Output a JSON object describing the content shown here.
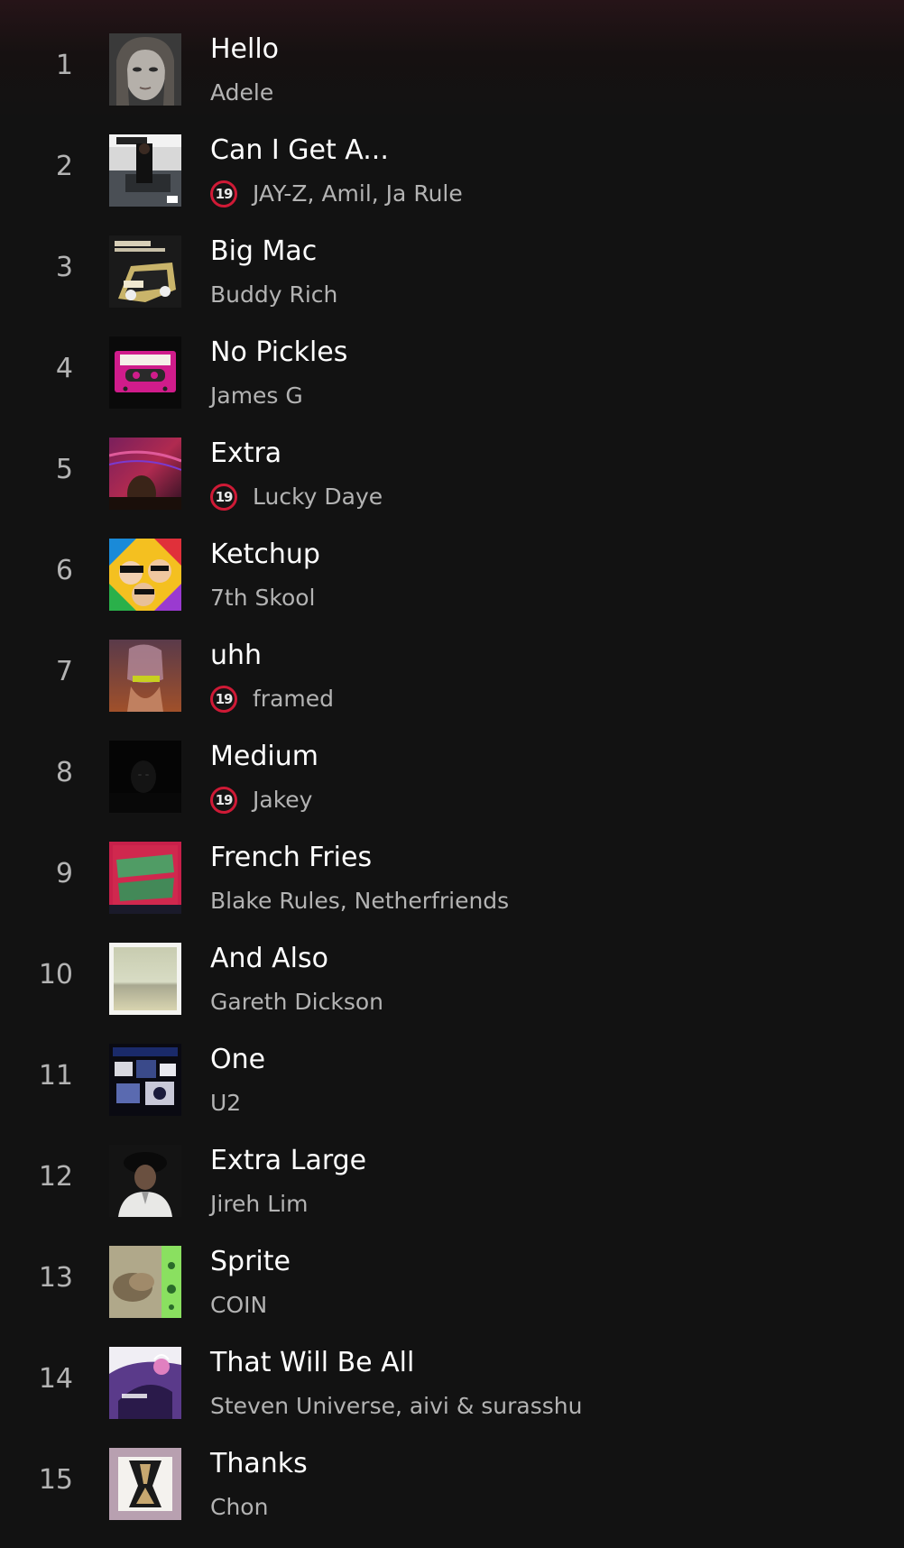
{
  "tracks": [
    {
      "number": "1",
      "title": "Hello",
      "artist": "Adele",
      "age_rating": null
    },
    {
      "number": "2",
      "title": "Can I Get A...",
      "artist": "JAY-Z, Amil, Ja Rule",
      "age_rating": "19"
    },
    {
      "number": "3",
      "title": "Big Mac",
      "artist": "Buddy Rich",
      "age_rating": null
    },
    {
      "number": "4",
      "title": "No Pickles",
      "artist": "James G",
      "age_rating": null
    },
    {
      "number": "5",
      "title": "Extra",
      "artist": "Lucky Daye",
      "age_rating": "19"
    },
    {
      "number": "6",
      "title": "Ketchup",
      "artist": "7th Skool",
      "age_rating": null
    },
    {
      "number": "7",
      "title": "uhh",
      "artist": "framed",
      "age_rating": "19"
    },
    {
      "number": "8",
      "title": "Medium",
      "artist": "Jakey",
      "age_rating": "19"
    },
    {
      "number": "9",
      "title": "French Fries",
      "artist": "Blake Rules, Netherfriends",
      "age_rating": null
    },
    {
      "number": "10",
      "title": "And Also",
      "artist": "Gareth Dickson",
      "age_rating": null
    },
    {
      "number": "11",
      "title": "One",
      "artist": "U2",
      "age_rating": null
    },
    {
      "number": "12",
      "title": "Extra Large",
      "artist": "Jireh Lim",
      "age_rating": null
    },
    {
      "number": "13",
      "title": "Sprite",
      "artist": "COIN",
      "age_rating": null
    },
    {
      "number": "14",
      "title": "That Will Be All",
      "artist": "Steven Universe, aivi & surasshu",
      "age_rating": null
    },
    {
      "number": "15",
      "title": "Thanks",
      "artist": "Chon",
      "age_rating": null
    }
  ],
  "colors": {
    "background": "#121212",
    "title_text": "#ffffff",
    "secondary_text": "#b3b3b3",
    "age_badge_ring": "#cf1a36"
  }
}
